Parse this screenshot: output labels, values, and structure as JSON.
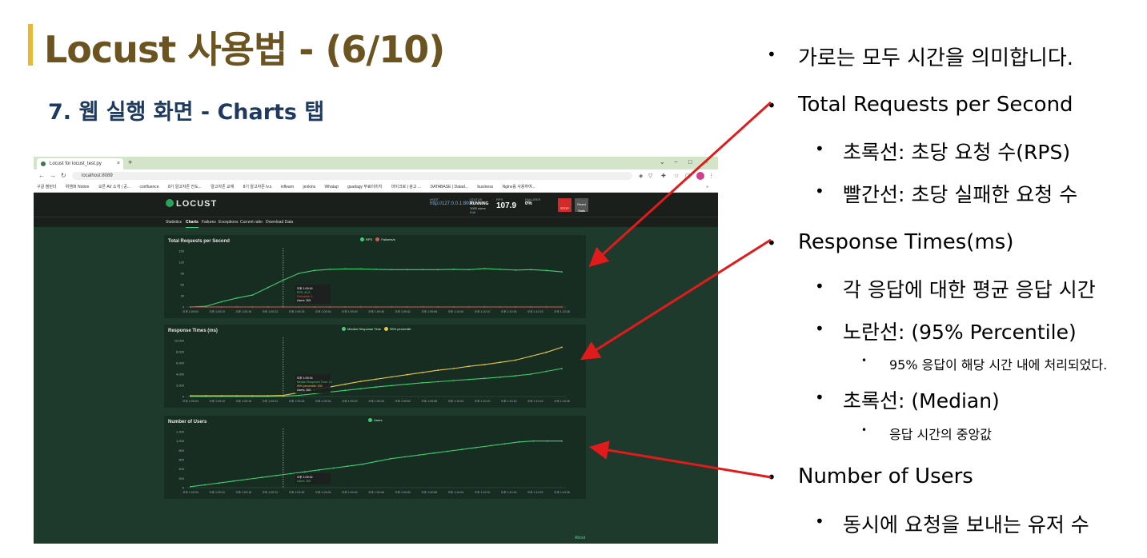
{
  "slide": {
    "title": "Locust 사용법 - (6/10)",
    "subtitle": "7. 웹 실행 화면 - Charts 탭"
  },
  "browser": {
    "tab_title": "Locust for locust_test.py",
    "tab_close": "×",
    "new_tab": "+",
    "window_controls": [
      "⌄",
      "−",
      "□",
      "×"
    ],
    "url": "localhost:8089",
    "bookmarks": [
      "구글 캘린더",
      "위캠퍼 Notion",
      "오픈 AI/ 소개 | 공...",
      "confluence",
      "8기 알고자존 전도...",
      "알고자존 교재",
      "8기 알고자존 lv.s",
      "inflearn",
      "jenkins",
      "Whatap",
      "gsadagy 무료이미지",
      "마이크로 | 광고 ...",
      "DATABASE | Datad...",
      "business",
      "Nginx를 사용하여..."
    ],
    "bookmarks_more": "»"
  },
  "locust": {
    "logo": "LOCUST",
    "host_label": "HOST",
    "host_value": "http://127.0.0.1:8000",
    "status_label": "STATUS",
    "status_value": "RUNNING",
    "status_users": "1000 users",
    "status_edit": "Edit",
    "rps_label": "RPS",
    "rps_value": "107.9",
    "failures_label": "FAILURES",
    "failures_value": "0%",
    "stop_label": "STOP",
    "reset_label": "Reset Stats",
    "tabs": [
      "Statistics",
      "Charts",
      "Failures",
      "Exceptions",
      "Current ratio",
      "Download Data"
    ],
    "footer": "About"
  },
  "chart_data": [
    {
      "type": "line",
      "title": "Total Requests per Second",
      "legend": [
        "RPS",
        "Failures/s"
      ],
      "yticks": [
        "150",
        "120",
        "90",
        "60",
        "30",
        "0"
      ],
      "xticks": [
        "오후 1:09:04",
        "오후 1:09:10",
        "오후 1:09:16",
        "오후 1:09:22",
        "오후 1:09:28",
        "오후 1:09:34",
        "오후 1:09:40",
        "오후 1:09:46",
        "오후 1:09:52",
        "오후 1:09:58",
        "오후 1:10:04",
        "오후 1:10:10",
        "오후 1:10:16",
        "오후 1:10:22",
        "오후 1:10:28"
      ],
      "ylim": [
        0,
        150
      ],
      "tooltip": [
        "오후 1:09:16",
        "RPS: 42.8",
        "Failures/s: 0",
        "Users: 300"
      ],
      "series": [
        {
          "name": "RPS",
          "color": "#3ecf6e",
          "values": [
            0,
            2,
            14,
            24,
            32,
            52,
            72,
            90,
            98,
            101,
            102,
            102,
            101,
            100,
            100,
            100,
            100,
            101,
            100,
            103,
            101,
            99,
            100,
            98,
            94
          ]
        },
        {
          "name": "Failures/s",
          "color": "#e0554a",
          "values": [
            0,
            0,
            0,
            0,
            0,
            0,
            0,
            0,
            0,
            0,
            0,
            0,
            0,
            0,
            0,
            0,
            0,
            0,
            0,
            0,
            0,
            0,
            0,
            0,
            0
          ]
        }
      ]
    },
    {
      "type": "line",
      "title": "Response Times (ms)",
      "legend": [
        "Median Response Time",
        "95% percentile"
      ],
      "yticks": [
        "10,000",
        "8,000",
        "6,000",
        "4,000",
        "2,000",
        "0"
      ],
      "xticks": [
        "오후 1:09:04",
        "오후 1:09:10",
        "오후 1:09:16",
        "오후 1:09:22",
        "오후 1:09:28",
        "오후 1:09:34",
        "오후 1:09:40",
        "오후 1:09:46",
        "오후 1:09:52",
        "오후 1:09:58",
        "오후 1:10:04",
        "오후 1:10:10",
        "오후 1:10:16",
        "오후 1:10:22",
        "오후 1:10:28"
      ],
      "ylim": [
        0,
        10000
      ],
      "tooltip": [
        "오후 1:09:16",
        "Median Response Time: 14",
        "95% percentile: 200",
        "Users: 300"
      ],
      "series": [
        {
          "name": "Median Response Time",
          "color": "#3ecf6e",
          "values": [
            20,
            20,
            20,
            20,
            20,
            20,
            40,
            200,
            500,
            800,
            1100,
            1400,
            1700,
            1950,
            2200,
            2450,
            2650,
            2850,
            3050,
            3250,
            3450,
            3700,
            4000,
            4500,
            5000
          ]
        },
        {
          "name": "95% percentile",
          "color": "#e8c84a",
          "values": [
            150,
            150,
            150,
            150,
            150,
            150,
            200,
            700,
            1200,
            1700,
            2200,
            2700,
            3100,
            3500,
            3900,
            4300,
            4700,
            5000,
            5400,
            5700,
            6100,
            6500,
            7200,
            7900,
            8800
          ]
        }
      ]
    },
    {
      "type": "line",
      "title": "Number of Users",
      "legend": [
        "Users"
      ],
      "yticks": [
        "1,200",
        "1,000",
        "800",
        "600",
        "400",
        "200",
        "0"
      ],
      "xticks": [
        "오후 1:09:04",
        "오후 1:09:10",
        "오후 1:09:16",
        "오후 1:09:22",
        "오후 1:09:28",
        "오후 1:09:34",
        "오후 1:09:40",
        "오후 1:09:46",
        "오후 1:09:52",
        "오후 1:09:58",
        "오후 1:10:04",
        "오후 1:10:10",
        "오후 1:10:16",
        "오후 1:10:22",
        "오후 1:10:28"
      ],
      "ylim": [
        0,
        1200
      ],
      "tooltip": [
        "오후 1:09:16",
        "Users: 300"
      ],
      "series": [
        {
          "name": "Users",
          "color": "#3ecf6e",
          "values": [
            20,
            60,
            100,
            140,
            180,
            220,
            260,
            300,
            340,
            380,
            420,
            460,
            500,
            560,
            620,
            660,
            700,
            740,
            780,
            820,
            860,
            900,
            940,
            980,
            1000,
            1000,
            1000
          ]
        }
      ]
    }
  ],
  "bullets": [
    {
      "level": 1,
      "text": "가로는 모두 시간을 의미합니다."
    },
    {
      "level": 1,
      "text": "Total Requests per Second"
    },
    {
      "level": 2,
      "text": "초록선: 초당 요청 수(RPS)"
    },
    {
      "level": 2,
      "text": "빨간선: 초당 실패한 요청 수"
    },
    {
      "level": 1,
      "text": "Response Times(ms)"
    },
    {
      "level": 2,
      "text": "각 응답에 대한 평균 응답 시간"
    },
    {
      "level": 2,
      "text": "노란선: (95% Percentile)"
    },
    {
      "level": 3,
      "text": "95% 응답이 해당 시간 내에 처리되었다."
    },
    {
      "level": 2,
      "text": "초록선: (Median)"
    },
    {
      "level": 3,
      "text": "응답 시간의 중앙값"
    },
    {
      "level": 1,
      "text": "Number of Users"
    },
    {
      "level": 2,
      "text": "동시에 요청을 보내는 유저 수"
    }
  ],
  "colors": {
    "arrow": "#e01b1b",
    "title": "#6b5420",
    "subtitle": "#1f3a5f",
    "accent": "#e8b830"
  }
}
